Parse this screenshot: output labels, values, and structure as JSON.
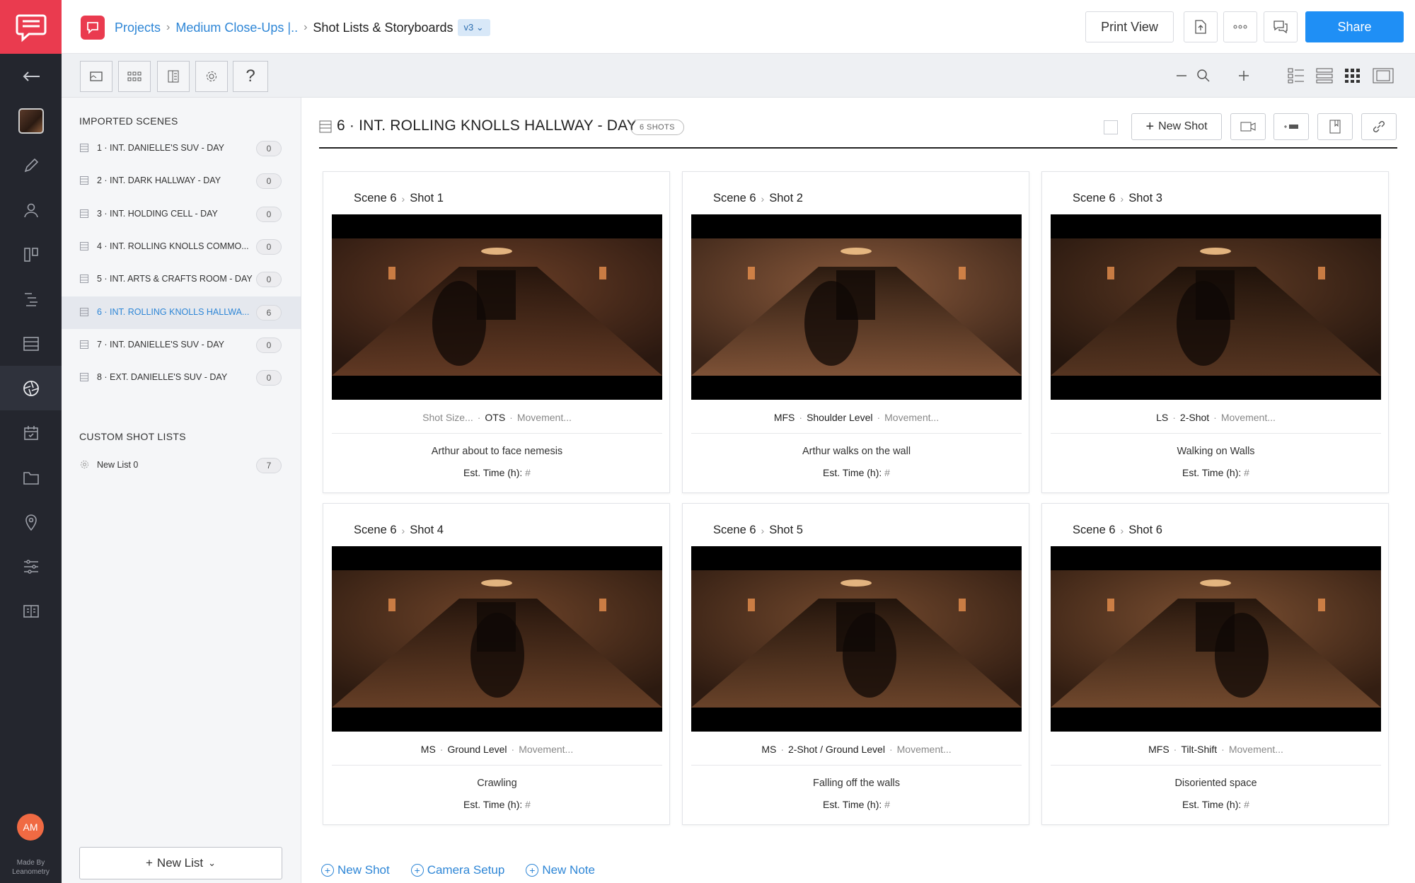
{
  "rail": {
    "made_by_line1": "Made By",
    "made_by_line2": "Leanometry",
    "avatar": "AM",
    "icons": [
      "back-arrow-icon",
      "pencil-icon",
      "user-icon",
      "board-icon",
      "gantt-icon",
      "list-icon",
      "shot-list-icon",
      "calendar-icon",
      "folder-icon",
      "location-icon",
      "sliders-icon",
      "book-icon"
    ]
  },
  "topbar": {
    "breadcrumb": [
      "Projects",
      "Medium Close-Ups |..",
      "Shot Lists & Storyboards"
    ],
    "version": "v3",
    "print_view": "Print View",
    "share": "Share"
  },
  "sidebar": {
    "imported_heading": "IMPORTED SCENES",
    "scenes": [
      {
        "label": "1 · INT. DANIELLE'S SUV - DAY",
        "count": "0"
      },
      {
        "label": "2 · INT. DARK HALLWAY - DAY",
        "count": "0"
      },
      {
        "label": "3 · INT. HOLDING CELL - DAY",
        "count": "0"
      },
      {
        "label": "4 · INT. ROLLING KNOLLS COMMO...",
        "count": "0"
      },
      {
        "label": "5 · INT. ARTS & CRAFTS ROOM - DAY",
        "count": "0"
      },
      {
        "label": "6 · INT. ROLLING KNOLLS HALLWA...",
        "count": "6"
      },
      {
        "label": "7 · INT. DANIELLE'S SUV - DAY",
        "count": "0"
      },
      {
        "label": "8 · EXT. DANIELLE'S SUV - DAY",
        "count": "0"
      }
    ],
    "active_index": 5,
    "custom_heading": "CUSTOM SHOT LISTS",
    "custom_lists": [
      {
        "label": "New List 0",
        "count": "7"
      }
    ],
    "new_list": "New List"
  },
  "main": {
    "scene_title": "6 · INT. ROLLING KNOLLS HALLWAY - DAY",
    "shots_badge": "6 SHOTS",
    "new_shot": "New Shot",
    "est_label": "Est. Time (h):",
    "est_value": "#",
    "shots": [
      {
        "scene": "Scene 6",
        "shot": "Shot 1",
        "size": "Shot Size...",
        "size_muted": true,
        "angle": "OTS",
        "movement": "Movement...",
        "desc": "Arthur about to face nemesis"
      },
      {
        "scene": "Scene 6",
        "shot": "Shot 2",
        "size": "MFS",
        "size_muted": false,
        "angle": "Shoulder Level",
        "movement": "Movement...",
        "desc": "Arthur walks on the wall"
      },
      {
        "scene": "Scene 6",
        "shot": "Shot 3",
        "size": "LS",
        "size_muted": false,
        "angle": "2-Shot",
        "movement": "Movement...",
        "desc": "Walking on Walls"
      },
      {
        "scene": "Scene 6",
        "shot": "Shot 4",
        "size": "MS",
        "size_muted": false,
        "angle": "Ground Level",
        "movement": "Movement...",
        "desc": "Crawling"
      },
      {
        "scene": "Scene 6",
        "shot": "Shot 5",
        "size": "MS",
        "size_muted": false,
        "angle": "2-Shot / Ground Level",
        "movement": "Movement...",
        "desc": "Falling off the walls"
      },
      {
        "scene": "Scene 6",
        "shot": "Shot 6",
        "size": "MFS",
        "size_muted": false,
        "angle": "Tilt-Shift",
        "movement": "Movement...",
        "desc": "Disoriented space"
      }
    ],
    "bottom_actions": [
      "New Shot",
      "Camera Setup",
      "New Note"
    ]
  },
  "colors": {
    "brand": "#ea3b4f",
    "accent": "#1f8ff5",
    "link": "#2e86d6",
    "rail": "#24262e"
  }
}
